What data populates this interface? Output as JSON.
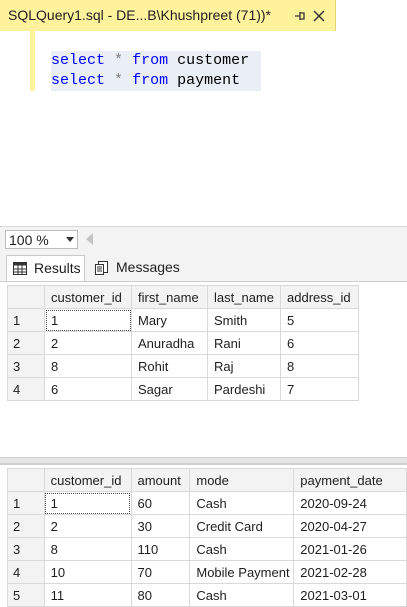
{
  "doc_tab": {
    "title": "SQLQuery1.sql - DE...B\\Khushpreet (71))*"
  },
  "editor": {
    "lines": [
      {
        "kw1": "select",
        "op": "*",
        "kw2": "from",
        "table": "customer"
      },
      {
        "kw1": "select",
        "op": "*",
        "kw2": "from",
        "table": "payment"
      }
    ]
  },
  "zoom": {
    "value": "100 %"
  },
  "results_tabs": [
    {
      "label": "Results"
    },
    {
      "label": "Messages"
    }
  ],
  "grid1": {
    "headers": [
      "customer_id",
      "first_name",
      "last_name",
      "address_id"
    ],
    "rows": [
      [
        "1",
        "1",
        "Mary",
        "Smith",
        "5"
      ],
      [
        "2",
        "2",
        "Anuradha",
        "Rani",
        "6"
      ],
      [
        "3",
        "8",
        "Rohit",
        "Raj",
        "8"
      ],
      [
        "4",
        "6",
        "Sagar",
        "Pardeshi",
        "7"
      ]
    ]
  },
  "grid2": {
    "headers": [
      "customer_id",
      "amount",
      "mode",
      "payment_date"
    ],
    "rows": [
      [
        "1",
        "1",
        "60",
        "Cash",
        "2020-09-24"
      ],
      [
        "2",
        "2",
        "30",
        "Credit Card",
        "2020-04-27"
      ],
      [
        "3",
        "8",
        "110",
        "Cash",
        "2021-01-26"
      ],
      [
        "4",
        "10",
        "70",
        "Mobile Payment",
        "2021-02-28"
      ],
      [
        "5",
        "11",
        "80",
        "Cash",
        "2021-03-01"
      ]
    ]
  }
}
